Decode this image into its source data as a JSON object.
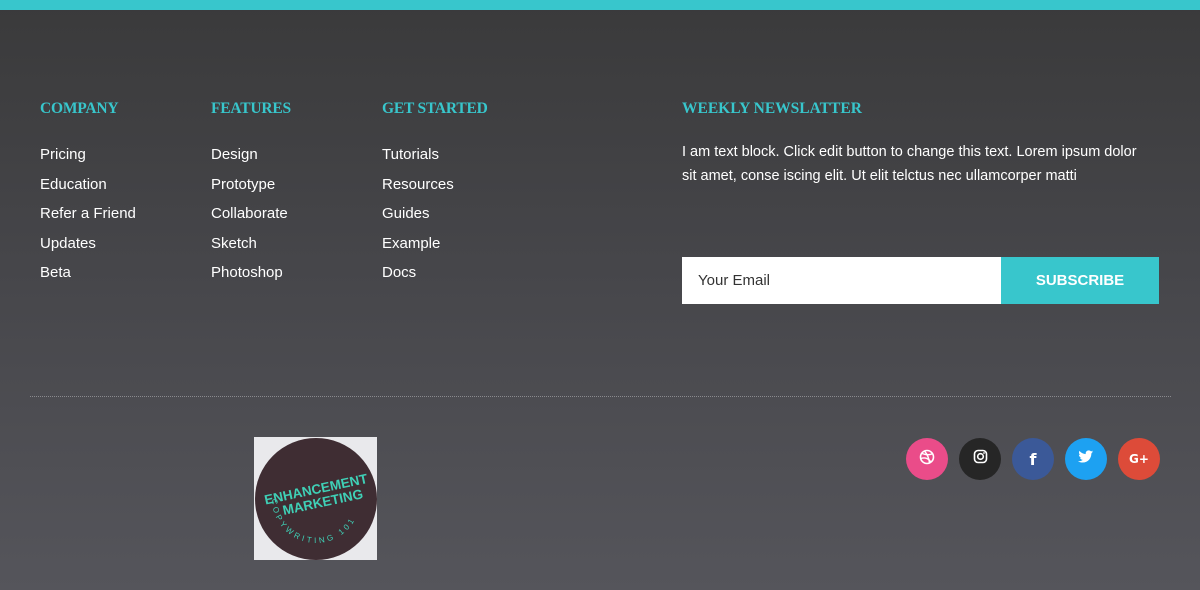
{
  "columns": {
    "company": {
      "title": "COMPANY",
      "links": [
        "Pricing",
        "Education",
        "Refer a Friend",
        "Updates",
        "Beta"
      ]
    },
    "features": {
      "title": "FEATURES",
      "links": [
        "Design",
        "Prototype",
        "Collaborate",
        "Sketch",
        "Photoshop"
      ]
    },
    "get_started": {
      "title": "GET STARTED",
      "links": [
        "Tutorials",
        "Resources",
        "Guides",
        "Example",
        "Docs"
      ]
    }
  },
  "newsletter": {
    "title": "WEEKLY NEWSLATTER",
    "text": "I am text block. Click edit button to change this text. Lorem ipsum dolor sit amet, conse iscing elit. Ut elit telctus nec ullamcorper matti",
    "email_placeholder": "Your Email",
    "subscribe_label": "SUBSCRIBE"
  },
  "logo": {
    "line1": "ENHANCEMENT",
    "line2": "MARKETING",
    "ring_text": "COPYWRITING 101"
  },
  "social": [
    {
      "name": "dribbble-icon",
      "glyph": "",
      "color": "#ea4c89"
    },
    {
      "name": "instagram-icon",
      "glyph": "",
      "color": "#262626"
    },
    {
      "name": "facebook-icon",
      "glyph": "f",
      "color": "#3b5998"
    },
    {
      "name": "twitter-icon",
      "glyph": "",
      "color": "#1da1f2"
    },
    {
      "name": "google-plus-icon",
      "glyph": "G+",
      "color": "#dd4b39"
    }
  ],
  "colors": {
    "accent": "#38c6cc",
    "background_top": "#3a3a3b",
    "background_bottom": "#55555b"
  }
}
